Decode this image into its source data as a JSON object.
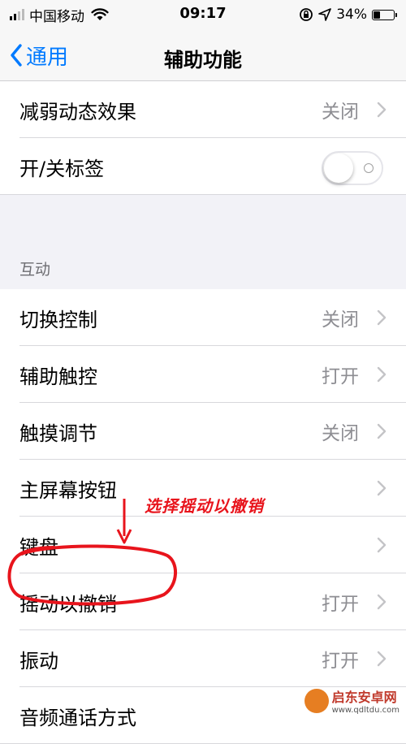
{
  "status_bar": {
    "carrier": "中国移动",
    "time": "09:17",
    "battery": "34%",
    "battery_level": 0.34
  },
  "nav": {
    "back_label": "通用",
    "title": "辅助功能"
  },
  "group1": [
    {
      "label": "减弱动态效果",
      "value": "关闭"
    },
    {
      "label": "开/关标签",
      "toggle": false
    }
  ],
  "section_interaction": {
    "header": "互动",
    "items": [
      {
        "label": "切换控制",
        "value": "关闭"
      },
      {
        "label": "辅助触控",
        "value": "打开"
      },
      {
        "label": "触摸调节",
        "value": "关闭"
      },
      {
        "label": "主屏幕按钮",
        "value": ""
      },
      {
        "label": "键盘",
        "value": ""
      },
      {
        "label": "摇动以撤销",
        "value": "打开"
      },
      {
        "label": "振动",
        "value": "打开"
      },
      {
        "label": "音频通话方式",
        "value": ""
      }
    ]
  },
  "annotation": {
    "text": "选择摇动以撤销",
    "color": "#e8141c"
  },
  "watermark": {
    "name": "启东安卓网",
    "url": "www.qdltdu.com"
  },
  "colors": {
    "accent": "#007aff",
    "secondary_text": "#8e8e93",
    "background": "#f2f2f7"
  }
}
